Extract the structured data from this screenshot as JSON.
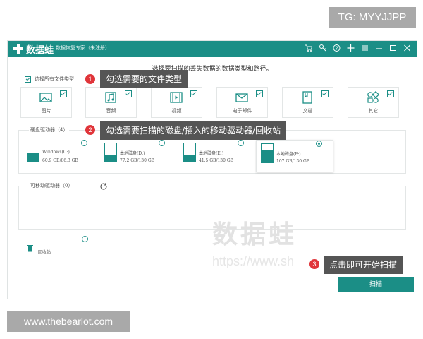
{
  "tg_label": "TG: MYYJJPP",
  "site_footer": "www.thebearlot.com",
  "app": {
    "logo_text": "数据蛙",
    "name": "数据恢复专家（未注册）",
    "header": "选择要扫描的丢失数据的数据类型和路径。",
    "select_all": "选择所有文件类型"
  },
  "file_types": [
    {
      "label": "图片",
      "icon": "picture-icon"
    },
    {
      "label": "音频",
      "icon": "music-icon"
    },
    {
      "label": "视频",
      "icon": "video-icon"
    },
    {
      "label": "电子邮件",
      "icon": "email-icon"
    },
    {
      "label": "文档",
      "icon": "document-icon"
    },
    {
      "label": "其它",
      "icon": "other-icon"
    }
  ],
  "hdd": {
    "title": "硬盘驱动器（4）",
    "drives": [
      {
        "name": "Windows(C:)",
        "size": "60.9 GB/86.3 GB",
        "selected": false
      },
      {
        "name": "本地磁盘(D:)",
        "size": "77.2 GB/130 GB",
        "selected": false
      },
      {
        "name": "本地磁盘(E:)",
        "size": "41.5 GB/130 GB",
        "selected": false
      },
      {
        "name": "本地磁盘(F:)",
        "size": "107 GB/130 GB",
        "selected": true
      }
    ]
  },
  "removable": {
    "title": "可移动驱动器（0）"
  },
  "recycle_bin": "回收站",
  "scan_button": "扫描",
  "annotations": [
    {
      "num": "1",
      "text": "勾选需要的文件类型"
    },
    {
      "num": "2",
      "text": "勾选需要扫描的磁盘/插入的移动驱动器/回收站"
    },
    {
      "num": "3",
      "text": "点击即可开始扫描"
    }
  ],
  "watermark": {
    "cn": "数据蛙",
    "url": "https://www.sh"
  }
}
